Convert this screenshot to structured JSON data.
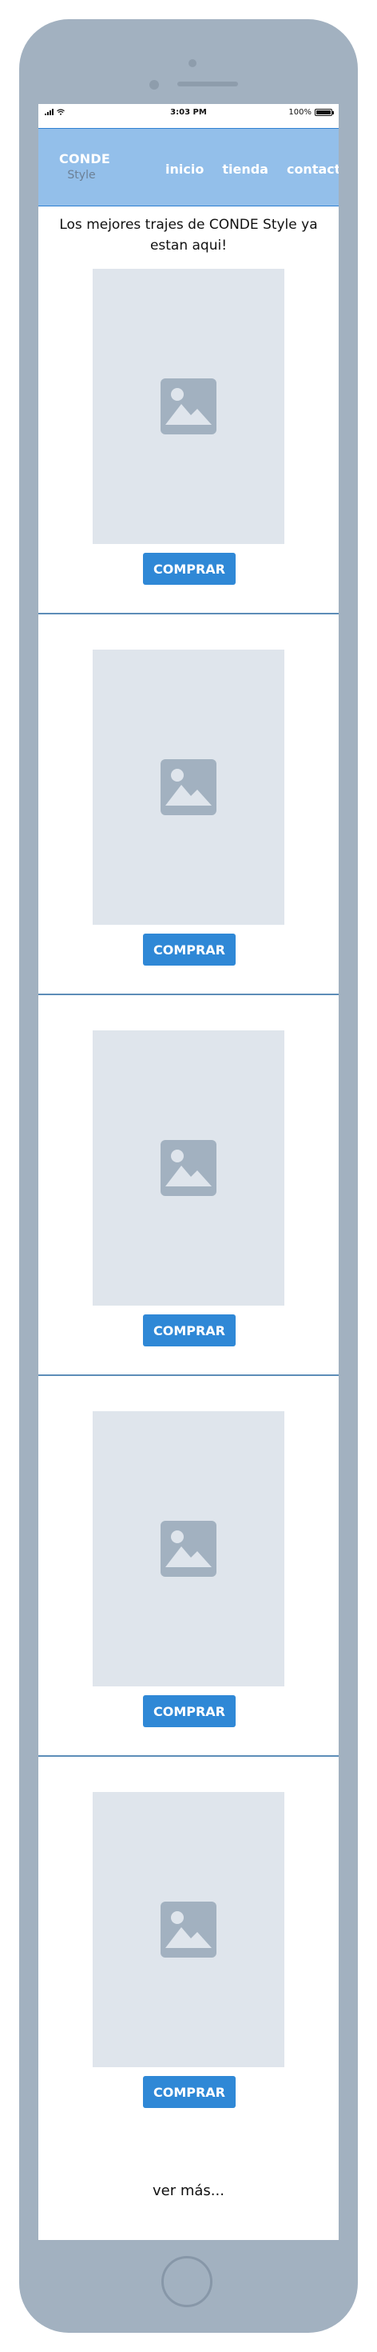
{
  "status_bar": {
    "time": "3:03 PM",
    "battery": "100%"
  },
  "navbar": {
    "brand_name": "CONDE",
    "brand_sub": "Style",
    "links": [
      "inicio",
      "tienda",
      "contacto"
    ]
  },
  "tagline": "Los mejores trajes de CONDE Style ya estan aqui!",
  "products": [
    {
      "button_label": "COMPRAR"
    },
    {
      "button_label": "COMPRAR"
    },
    {
      "button_label": "COMPRAR"
    },
    {
      "button_label": "COMPRAR"
    },
    {
      "button_label": "COMPRAR"
    }
  ],
  "more_link": "ver más...",
  "icons": {
    "product_image": "image-placeholder-icon",
    "signal": "signal-icon",
    "wifi": "wifi-icon",
    "battery": "battery-icon"
  },
  "colors": {
    "device": "#a2b1c0",
    "navbar": "#93bfea",
    "button": "#2f88d6",
    "placeholder": "#dfe5ec"
  }
}
